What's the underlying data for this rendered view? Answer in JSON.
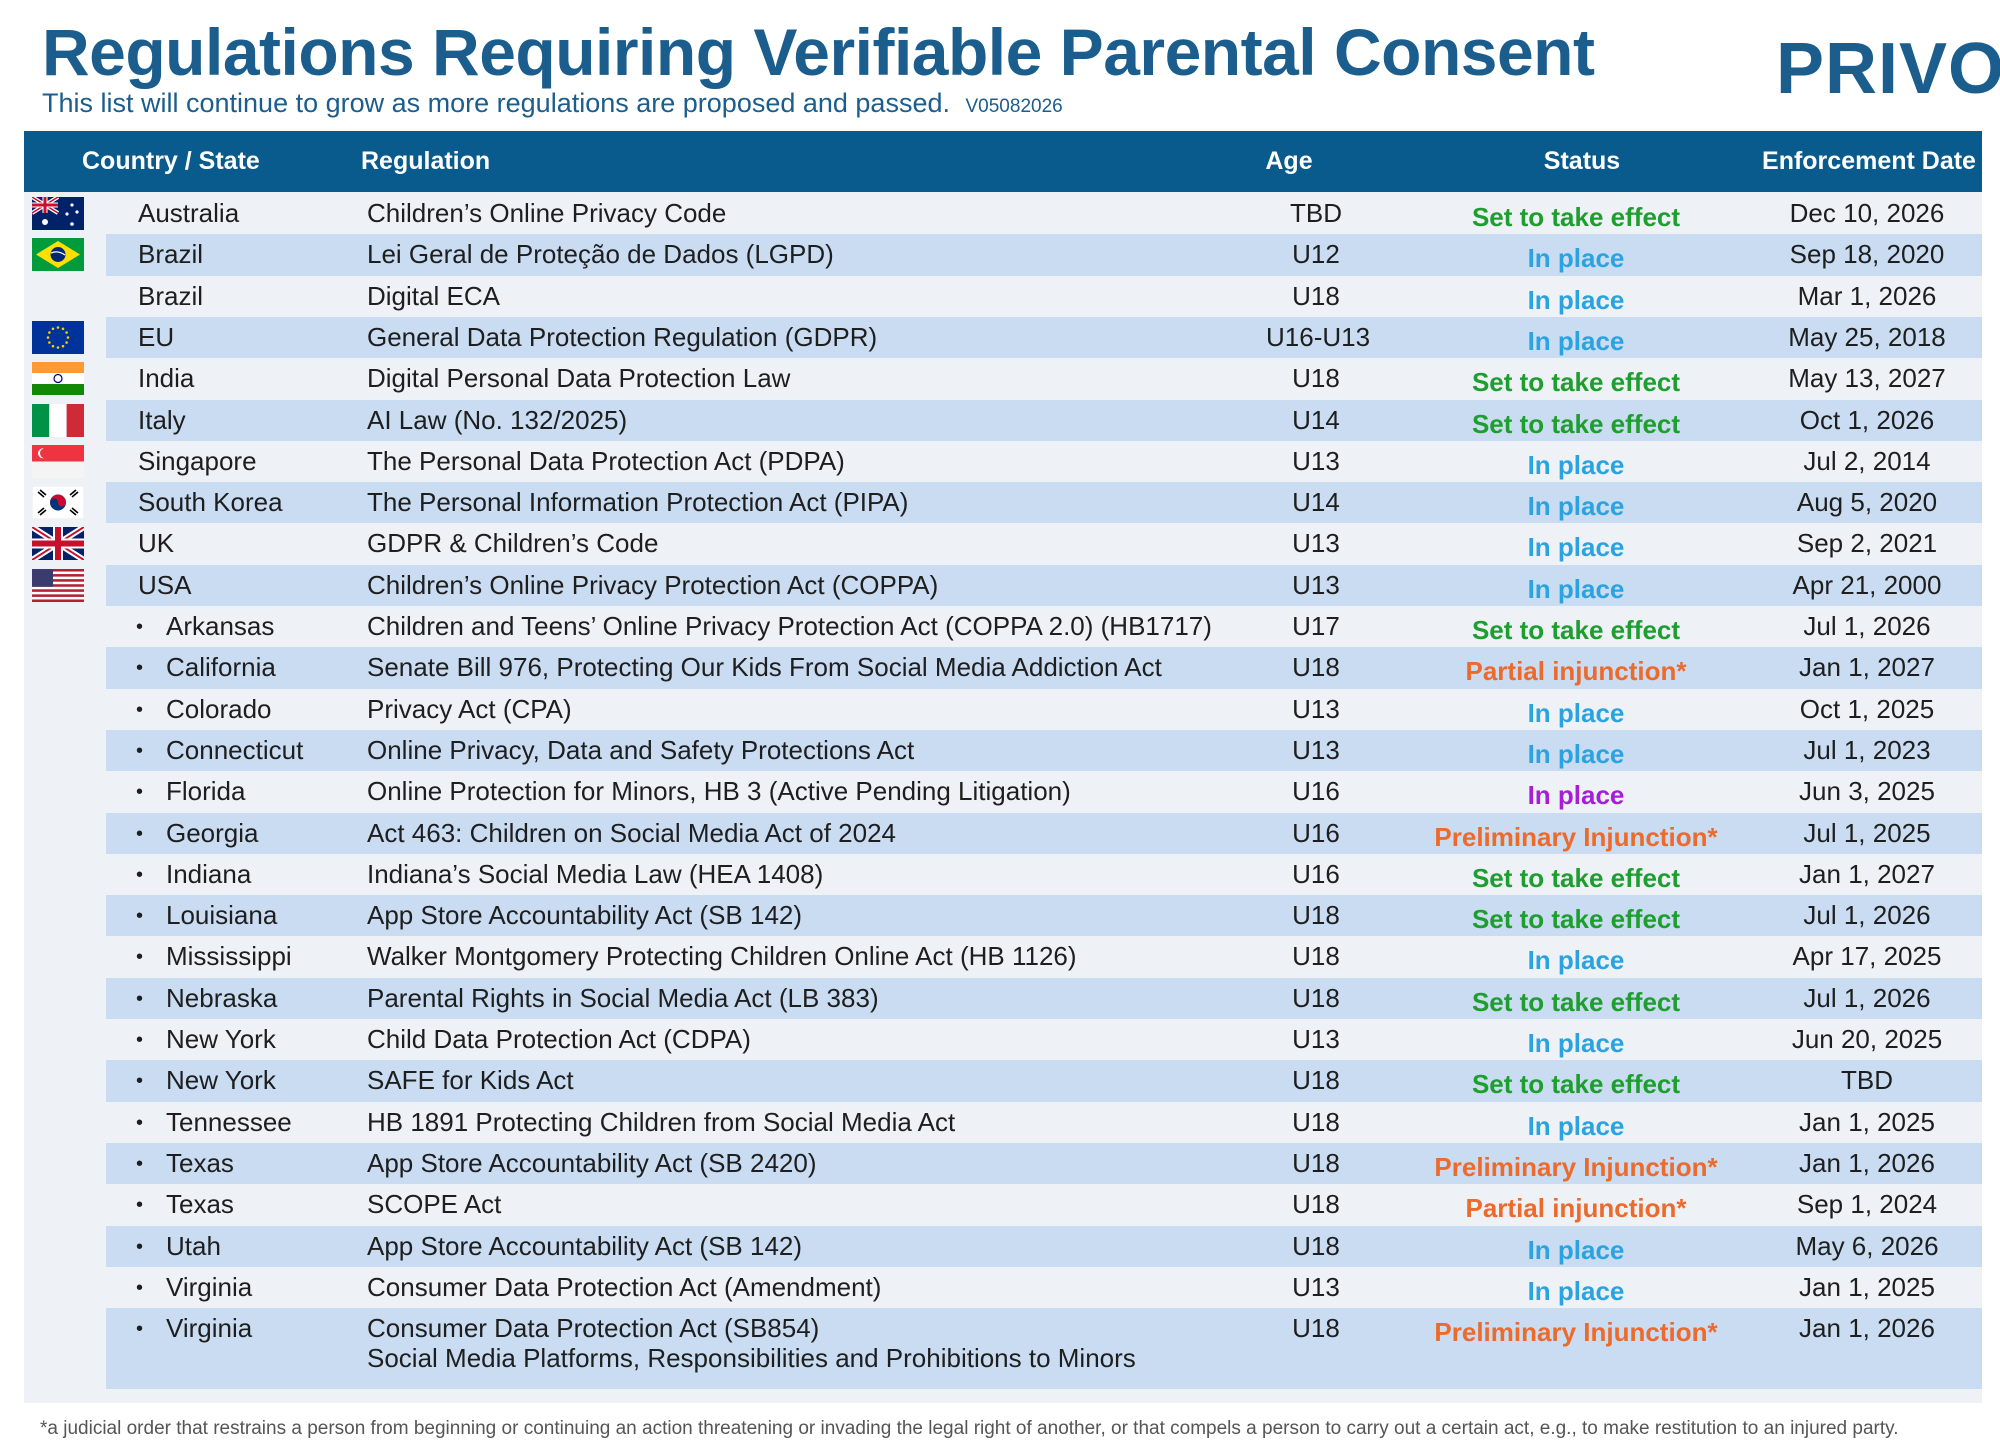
{
  "header": {
    "title": "Regulations Requiring Verifiable Parental Consent",
    "subtitle": "This list will continue to grow as more regulations are proposed and passed.",
    "version": "V05082026",
    "logo": "PRIVO"
  },
  "table": {
    "columns": [
      "Country / State",
      "Regulation",
      "Age",
      "Status",
      "Enforcement Date"
    ],
    "rows": [
      {
        "country": "Australia",
        "regulation": "Children’s Online Privacy Code",
        "age": "TBD",
        "status": "Set to take effect",
        "date": "Dec 10, 2026",
        "flag": "australia-flag-icon"
      },
      {
        "country": "Brazil",
        "regulation": "Lei Geral de Proteção de Dados (LGPD)",
        "age": "U12",
        "status": "In place",
        "date": "Sep 18, 2020",
        "flag": "brazil-flag-icon"
      },
      {
        "country": "Brazil",
        "regulation": "Digital ECA",
        "age": "U18",
        "status": "In place",
        "date": "Mar 1, 2026"
      },
      {
        "country": "EU",
        "regulation": "General Data Protection Regulation (GDPR)",
        "age": "U16-U13",
        "status": "In place",
        "date": "May 25, 2018",
        "flag": "eu-flag-icon"
      },
      {
        "country": "India",
        "regulation": "Digital Personal Data Protection Law",
        "age": "U18",
        "status": "Set to take effect",
        "date": "May 13, 2027",
        "flag": "india-flag-icon"
      },
      {
        "country": "Italy",
        "regulation": "AI Law (No. 132/2025)",
        "age": "U14",
        "status": "Set to take effect",
        "date": "Oct 1, 2026",
        "flag": "italy-flag-icon"
      },
      {
        "country": "Singapore",
        "regulation": "The Personal Data Protection Act (PDPA)",
        "age": "U13",
        "status": "In place",
        "date": "Jul 2, 2014",
        "flag": "singapore-flag-icon"
      },
      {
        "country": "South Korea",
        "regulation": "The Personal Information Protection Act (PIPA)",
        "age": "U14",
        "status": "In place",
        "date": "Aug 5, 2020",
        "flag": "south-korea-flag-icon"
      },
      {
        "country": "UK",
        "regulation": "GDPR & Children’s Code",
        "age": "U13",
        "status": "In place",
        "date": "Sep 2, 2021",
        "flag": "uk-flag-icon"
      },
      {
        "country": "USA",
        "regulation": "Children’s Online Privacy Protection Act (COPPA)",
        "age": "U13",
        "status": "In place",
        "date": "Apr 21, 2000",
        "flag": "usa-flag-icon"
      },
      {
        "country": "Arkansas",
        "regulation": "Children and Teens’ Online Privacy Protection Act (COPPA 2.0) (HB1717)",
        "age": "U17",
        "status": "Set to take effect",
        "date": "Jul 1, 2026",
        "sub": true
      },
      {
        "country": "California",
        "regulation": "Senate Bill 976, Protecting Our Kids From Social Media Addiction Act",
        "age": "U18",
        "status": "Partial injunction*",
        "date": "Jan 1, 2027",
        "sub": true
      },
      {
        "country": "Colorado",
        "regulation": "Privacy Act (CPA)",
        "age": "U13",
        "status": "In place",
        "date": "Oct 1, 2025",
        "sub": true
      },
      {
        "country": "Connecticut",
        "regulation": "Online Privacy, Data and Safety Protections Act",
        "age": "U13",
        "status": "In place",
        "date": "Jul 1, 2023",
        "sub": true
      },
      {
        "country": "Florida",
        "regulation": "Online Protection for Minors, HB 3 (Active Pending Litigation)",
        "age": "U16",
        "status": "In place",
        "date": "Jun 3, 2025",
        "sub": true,
        "status_style": "purple"
      },
      {
        "country": "Georgia",
        "regulation": "Act 463: Children on Social Media Act of 2024",
        "age": "U16",
        "status": "Preliminary Injunction*",
        "date": "Jul 1, 2025",
        "sub": true
      },
      {
        "country": "Indiana",
        "regulation": "Indiana’s Social Media Law (HEA 1408)",
        "age": "U16",
        "status": "Set to take effect",
        "date": "Jan 1, 2027",
        "sub": true
      },
      {
        "country": "Louisiana",
        "regulation": "App Store Accountability Act (SB 142)",
        "age": "U18",
        "status": "Set to take effect",
        "date": "Jul 1, 2026",
        "sub": true
      },
      {
        "country": "Mississippi",
        "regulation": "Walker Montgomery Protecting Children Online Act (HB 1126)",
        "age": "U18",
        "status": "In place",
        "date": "Apr 17, 2025",
        "sub": true
      },
      {
        "country": "Nebraska",
        "regulation": "Parental Rights in Social Media Act (LB 383)",
        "age": "U18",
        "status": "Set to take effect",
        "date": "Jul 1, 2026",
        "sub": true
      },
      {
        "country": "New York",
        "regulation": "Child Data Protection Act (CDPA)",
        "age": "U13",
        "status": "In place",
        "date": "Jun 20, 2025",
        "sub": true
      },
      {
        "country": "New York",
        "regulation": "SAFE for Kids Act",
        "age": "U18",
        "status": "Set to take effect",
        "date": "TBD",
        "sub": true
      },
      {
        "country": "Tennessee",
        "regulation": "HB 1891 Protecting Children from Social Media Act",
        "age": "U18",
        "status": "In place",
        "date": "Jan 1, 2025",
        "sub": true
      },
      {
        "country": "Texas",
        "regulation": "App Store Accountability Act (SB 2420)",
        "age": "U18",
        "status": "Preliminary Injunction*",
        "date": "Jan 1, 2026",
        "sub": true
      },
      {
        "country": "Texas",
        "regulation": "SCOPE Act",
        "age": "U18",
        "status": "Partial injunction*",
        "date": "Sep 1, 2024",
        "sub": true
      },
      {
        "country": "Utah",
        "regulation": "App Store Accountability Act (SB 142)",
        "age": "U18",
        "status": "In place",
        "date": "May 6, 2026",
        "sub": true
      },
      {
        "country": "Virginia",
        "regulation": "Consumer Data Protection Act (Amendment)",
        "age": "U13",
        "status": "In place",
        "date": "Jan 1, 2025",
        "sub": true
      },
      {
        "country": "Virginia",
        "regulation": "Consumer Data Protection Act (SB854)",
        "regulation_line2": "Social Media Platforms, Responsibilities and Prohibitions to Minors",
        "age": "U18",
        "status": "Preliminary Injunction*",
        "date": "Jan 1, 2026",
        "sub": true
      }
    ]
  },
  "footnote": "*a judicial order that restrains a person from beginning or continuing an action threatening or invading the legal right of another, or that compels a person to carry out a certain act, e.g., to make restitution to an injured party.",
  "colors": {
    "brand": "#1b5d8c",
    "header_bar": "#085b8c",
    "row_shade": "#c9dcf2",
    "status_set_to_take_effect": "#1e9e2e",
    "status_in_place": "#2aa3e0",
    "status_injunction": "#ec6a2c",
    "status_in_place_litigation": "#a51fd6"
  }
}
